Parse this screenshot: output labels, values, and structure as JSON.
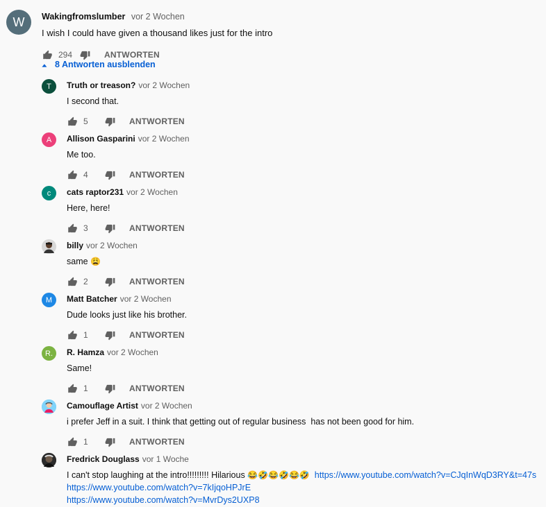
{
  "main_comment": {
    "avatar_letter": "W",
    "author": "Wakingfromslumber",
    "time": "vor 2 Wochen",
    "text": "I wish I could have given a thousand likes just for the intro",
    "likes": "294",
    "reply_label": "ANTWORTEN"
  },
  "toggle_replies": {
    "label": "8 Antworten ausblenden"
  },
  "replies": [
    {
      "avatar_letter": "T",
      "avatar_color": "#0b4f3c",
      "author": "Truth or treason?",
      "time": "vor 2 Wochen",
      "text": "I second that.",
      "likes": "5",
      "reply_label": "ANTWORTEN"
    },
    {
      "avatar_letter": "A",
      "avatar_color": "#ec407a",
      "author": "Allison Gasparini",
      "time": "vor 2 Wochen",
      "text": "Me too.",
      "likes": "4",
      "reply_label": "ANTWORTEN"
    },
    {
      "avatar_letter": "c",
      "avatar_color": "#00897b",
      "author": "cats raptor231",
      "time": "vor 2 Wochen",
      "text": "Here, here!",
      "likes": "3",
      "reply_label": "ANTWORTEN"
    },
    {
      "avatar_letter": "",
      "avatar_color": "#3a3a3a",
      "author": "billy",
      "time": "vor 2 Wochen",
      "text": "same",
      "emoji": "😩",
      "likes": "2",
      "reply_label": "ANTWORTEN"
    },
    {
      "avatar_letter": "M",
      "avatar_color": "#1e88e5",
      "author": "Matt Batcher",
      "time": "vor 2 Wochen",
      "text": "Dude looks just like his brother.",
      "likes": "1",
      "reply_label": "ANTWORTEN"
    },
    {
      "avatar_letter": "R.",
      "avatar_color": "#7cb342",
      "author": "R. Hamza",
      "time": "vor 2 Wochen",
      "text": "Same!",
      "likes": "1",
      "reply_label": "ANTWORTEN"
    },
    {
      "avatar_letter": "",
      "avatar_color": "#4fc3f7",
      "author": "Camouflage Artist",
      "time": "vor 2 Wochen",
      "text": "i prefer Jeff in a suit. I think that getting out of regular business  has not been good for him.",
      "likes": "1",
      "reply_label": "ANTWORTEN"
    },
    {
      "avatar_letter": "",
      "avatar_color": "#3e3e3e",
      "author": "Fredrick Douglass",
      "time": "vor 1 Woche",
      "text": "I can't stop laughing at the intro!!!!!!!!! Hilarious",
      "emoji": "😂🤣😂🤣😂🤣",
      "link1": "https://www.youtube.com/watch?v=CJqInWqD3RY&t=47s",
      "link2": "https://www.youtube.com/watch?v=7kIjqoHPJrE",
      "link3": "https://www.youtube.com/watch?v=MvrDys2UXP8"
    }
  ],
  "icons": {
    "like": "thumbs-up-icon",
    "dislike": "thumbs-down-icon",
    "caret": "caret-up-icon"
  },
  "colors": {
    "link": "#065fd4",
    "muted": "#606060"
  }
}
